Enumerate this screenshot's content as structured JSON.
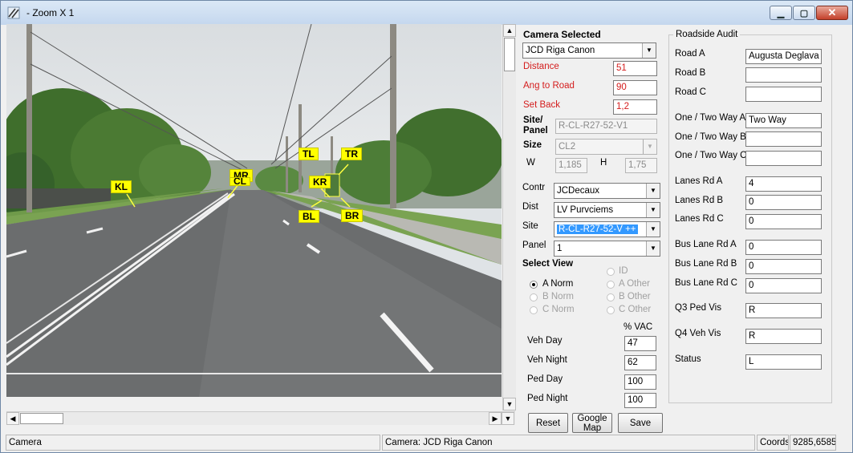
{
  "window": {
    "title": "- Zoom X 1"
  },
  "markers": {
    "kl": "KL",
    "mr": "MR",
    "cl": "CL",
    "tl": "TL",
    "tr": "TR",
    "kr": "KR",
    "bl": "BL",
    "br": "BR"
  },
  "camera": {
    "heading": "Camera Selected",
    "selected": "JCD Riga Canon",
    "distance_label": "Distance",
    "distance": "51",
    "ang_label": "Ang to Road",
    "ang": "90",
    "setback_label": "Set Back",
    "setback": "1,2",
    "site_panel_label_1": "Site/",
    "site_panel_label_2": "Panel",
    "site_panel": "R-CL-R27-52-V1",
    "size_label": "Size",
    "size": "CL2",
    "w_label": "W",
    "w": "1,185",
    "h_label": "H",
    "h": "1,75",
    "contr_label": "Contr",
    "contr": "JCDecaux",
    "dist_label": "Dist",
    "dist": "LV Purvciems",
    "site_label": "Site",
    "site": "R-CL-R27-52-V ++",
    "panel_label": "Panel",
    "panel": "1"
  },
  "select_view": {
    "heading": "Select View",
    "options": {
      "id": "ID",
      "a_norm": "A Norm",
      "a_other": "A Other",
      "b_norm": "B Norm",
      "b_other": "B Other",
      "c_norm": "C Norm",
      "c_other": "C Other"
    }
  },
  "vac": {
    "heading": "% VAC",
    "veh_day_label": "Veh Day",
    "veh_day": "47",
    "veh_night_label": "Veh Night",
    "veh_night": "62",
    "ped_day_label": "Ped Day",
    "ped_day": "100",
    "ped_night_label": "Ped Night",
    "ped_night": "100"
  },
  "buttons": {
    "reset": "Reset",
    "google_map_1": "Google",
    "google_map_2": "Map",
    "save": "Save"
  },
  "audit": {
    "title": "Roadside Audit",
    "road_a_label": "Road A",
    "road_a": "Augusta Deglava ie",
    "road_b_label": "Road B",
    "road_b": "",
    "road_c_label": "Road C",
    "road_c": "",
    "way_a_label": "One / Two Way A",
    "way_a": "Two Way",
    "way_b_label": "One / Two Way B",
    "way_b": "",
    "way_c_label": "One / Two Way C",
    "way_c": "",
    "lanes_a_label": "Lanes Rd A",
    "lanes_a": "4",
    "lanes_b_label": "Lanes Rd B",
    "lanes_b": "0",
    "lanes_c_label": "Lanes Rd C",
    "lanes_c": "0",
    "bus_a_label": "Bus Lane Rd A",
    "bus_a": "0",
    "bus_b_label": "Bus Lane Rd B",
    "bus_b": "0",
    "bus_c_label": "Bus Lane Rd C",
    "bus_c": "0",
    "q3_label": "Q3 Ped Vis",
    "q3": "R",
    "q4_label": "Q4 Veh Vis",
    "q4": "R",
    "status_label": "Status",
    "status": "L"
  },
  "statusbar": {
    "left": "Camera",
    "mid": "Camera: JCD Riga Canon",
    "coords_label": "Coords",
    "coords": "9285,6585"
  }
}
